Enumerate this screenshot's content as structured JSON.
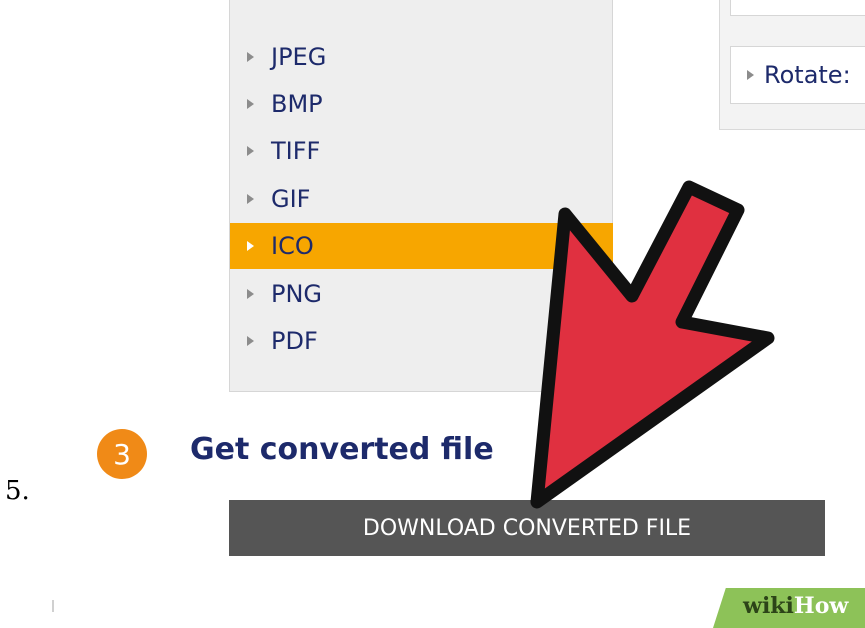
{
  "step": {
    "number": "5.",
    "badge": "3",
    "title": "Get converted file"
  },
  "formats": [
    {
      "label": "JPEG",
      "selected": false
    },
    {
      "label": "BMP",
      "selected": false
    },
    {
      "label": "TIFF",
      "selected": false
    },
    {
      "label": "GIF",
      "selected": false
    },
    {
      "label": "ICO",
      "selected": true
    },
    {
      "label": "PNG",
      "selected": false
    },
    {
      "label": "PDF",
      "selected": false
    }
  ],
  "options": {
    "rotate_label": "Rotate:"
  },
  "download": {
    "label": "DOWNLOAD CONVERTED FILE"
  },
  "watermark": {
    "brand_part1": "wiki",
    "brand_part2": "How"
  },
  "colors": {
    "highlight": "#f7a600",
    "badge": "#f08a17",
    "link_text": "#1d2a6b",
    "button": "#555555",
    "arrow": "#e03040"
  },
  "icons": {
    "pointer": "red-arrow-icon",
    "item_marker": "triangle-right-icon"
  }
}
